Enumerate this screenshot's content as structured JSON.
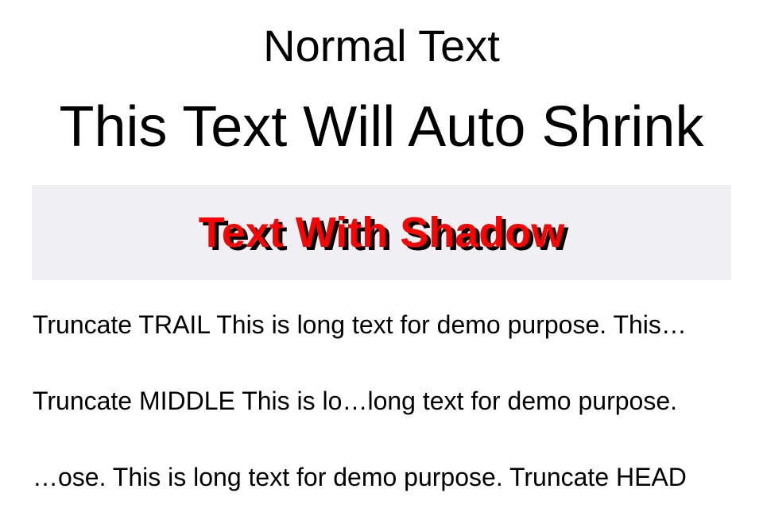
{
  "labels": {
    "normal": "Normal Text",
    "auto_shrink": "This Text Will Auto Shrink",
    "shadow": {
      "text": "Text With Shadow",
      "text_color": "#ff0000",
      "shadow_color": "#000000",
      "background_color": "#efeff4"
    },
    "truncate_trail": "Truncate TRAIL This is long text for demo purpose. This…",
    "truncate_middle": "Truncate MIDDLE This is lo…long text for demo purpose.",
    "truncate_head": "…ose. This is long text for demo purpose. Truncate HEAD"
  }
}
